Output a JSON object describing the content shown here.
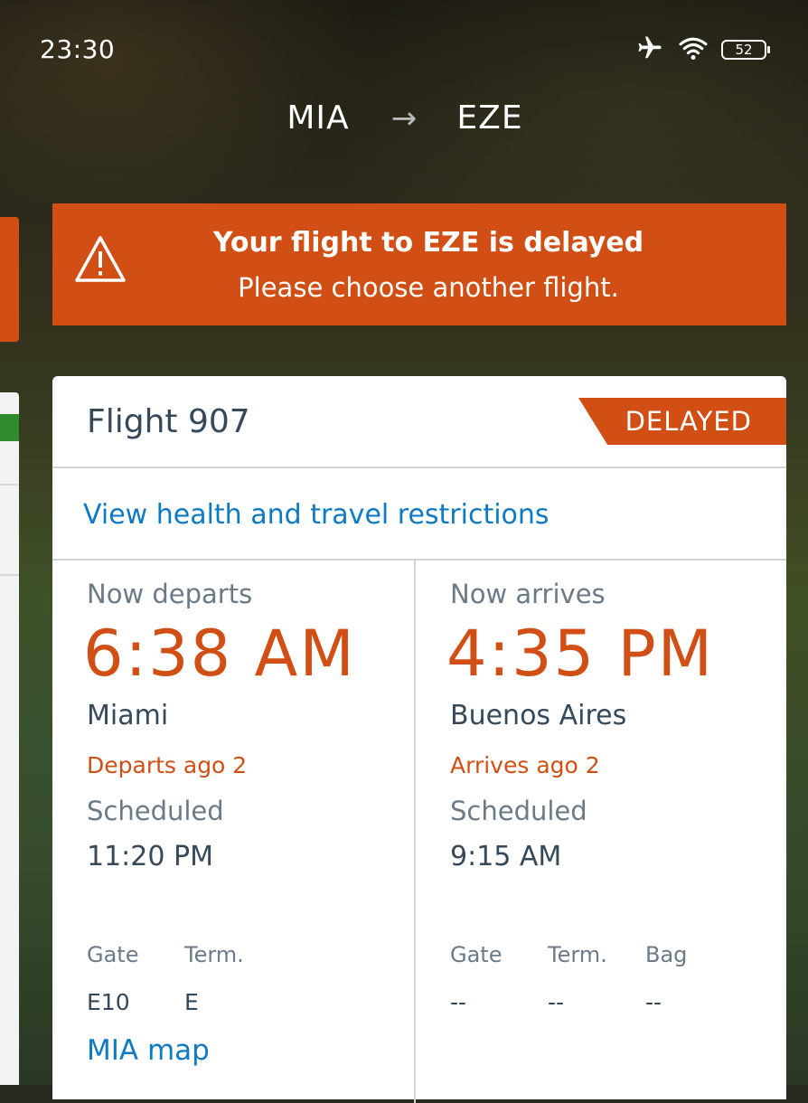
{
  "status_bar": {
    "time": "23:30",
    "icons": [
      "airplane-mode-icon",
      "wifi-icon"
    ],
    "battery": "52"
  },
  "route": {
    "origin": "MIA",
    "arrow": "→",
    "destination": "EZE"
  },
  "banner": {
    "title": "Your flight to EZE is delayed",
    "message": "Please choose another flight.",
    "icon": "warning-icon",
    "color": "#d14f14"
  },
  "flight": {
    "title": "Flight 907",
    "status": "DELAYED",
    "restrictions_link": "View health and travel restrictions",
    "departure": {
      "label": "Now departs",
      "time": "6:38 AM",
      "city": "Miami",
      "note": "Departs ago 2",
      "scheduled_label": "Scheduled",
      "scheduled_time": "11:20 PM",
      "gate_label": "Gate",
      "gate": "E10",
      "term_label": "Term.",
      "term": "E",
      "map_link": "MIA map"
    },
    "arrival": {
      "label": "Now arrives",
      "time": "4:35 PM",
      "city": "Buenos Aires",
      "note": "Arrives ago 2",
      "scheduled_label": "Scheduled",
      "scheduled_time": "9:15 AM",
      "gate_label": "Gate",
      "gate": "--",
      "term_label": "Term.",
      "term": "--",
      "bag_label": "Bag",
      "bag": "--"
    }
  },
  "colors": {
    "accent": "#d14f14",
    "link": "#0e7ac4",
    "text": "#36495a",
    "muted": "#6b7a88"
  }
}
